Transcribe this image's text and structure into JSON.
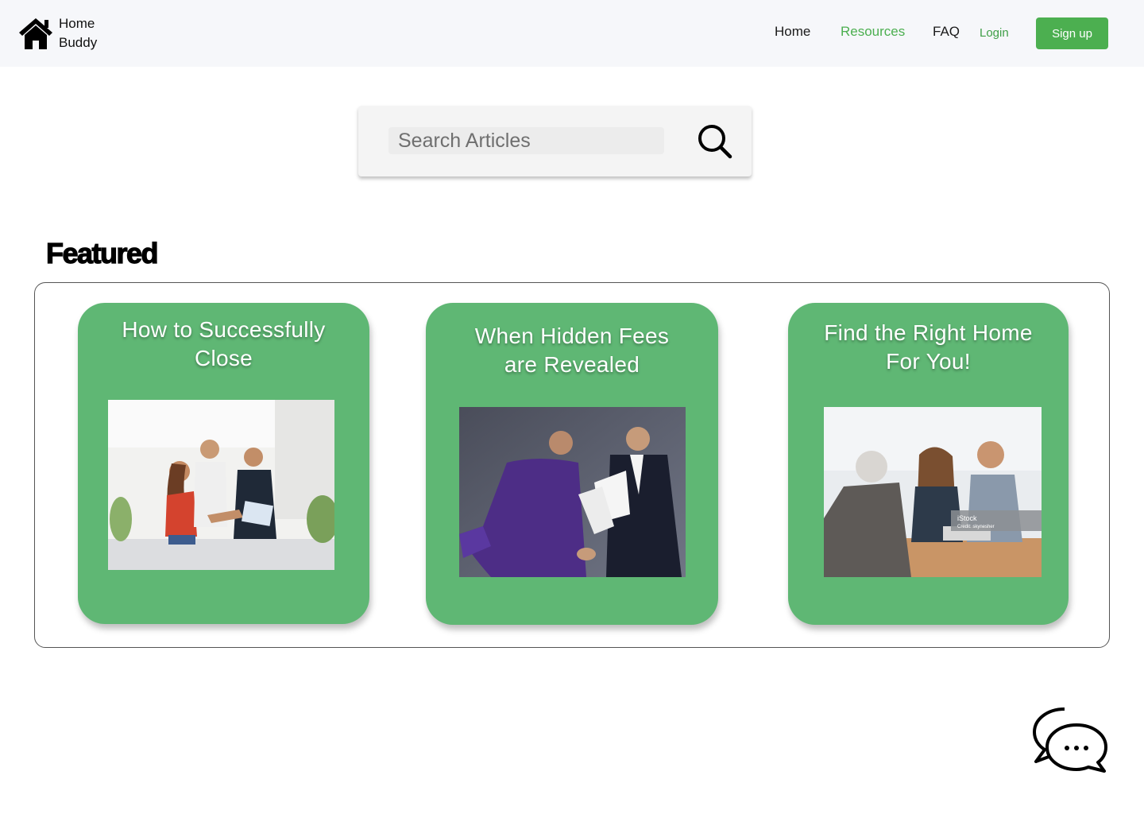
{
  "header": {
    "brand_line1": "Home",
    "brand_line2": "Buddy",
    "nav": [
      "Home",
      "Resources",
      "FAQ"
    ],
    "active_nav": "Resources",
    "login_label": "Login",
    "signup_label": "Sign up"
  },
  "search": {
    "placeholder": "Search Articles"
  },
  "featured": {
    "heading": "Featured",
    "cards": [
      {
        "title": "How to Successfully Close",
        "image": "handshake-photo"
      },
      {
        "title": "When Hidden Fees are Revealed",
        "image": "business-argument-photo"
      },
      {
        "title": "Find the Right Home For You!",
        "image": "meeting-photo",
        "image_caption": "iStock",
        "image_credit": "Credit: skynesher"
      }
    ]
  },
  "colors": {
    "accent": "#4caf50",
    "card": "#5fb774",
    "header_bg": "#f6f7fa"
  }
}
